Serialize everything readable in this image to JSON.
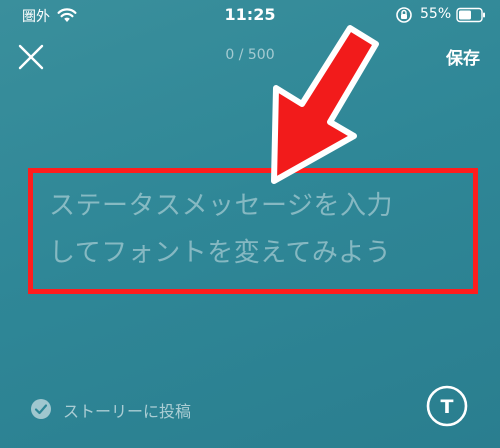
{
  "status_bar": {
    "carrier": "圏外",
    "time": "11:25",
    "battery": "55%",
    "icons": [
      "wifi-icon",
      "orientation-lock-icon",
      "battery-icon"
    ]
  },
  "header": {
    "close_icon": "close-icon",
    "char_count": "0 / 500",
    "save_label": "保存"
  },
  "message": {
    "placeholder_line1": "ステータスメッセージを入力",
    "placeholder_line2": "してフォントを変えてみよう"
  },
  "footer": {
    "story_label": "ストーリーに投稿",
    "story_checked": true,
    "font_button_glyph": "T"
  },
  "colors": {
    "background": "#2f8797",
    "highlight_border": "#ff1d1d",
    "arrow": "#f21b1b"
  }
}
